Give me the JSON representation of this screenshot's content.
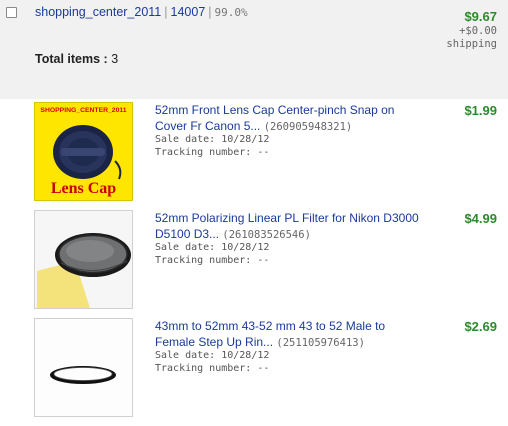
{
  "seller": {
    "name": "shopping_center_2011",
    "feedback_score": "14007",
    "positive_pct": "99.0%"
  },
  "order": {
    "total_price": "$9.67",
    "shipping_cost": "+$0.00",
    "shipping_label": "shipping",
    "total_items_label": "Total items :",
    "total_items_count": "3"
  },
  "items": [
    {
      "title": "52mm Front Lens Cap Center-pinch Snap on Cover Fr Canon 5...",
      "item_number": "(260905948321)",
      "sale_date": "Sale date: 10/28/12",
      "tracking": "Tracking number: --",
      "price": "$1.99",
      "thumb_text_top": "SHOPPING_CENTER_2011",
      "thumb_text_bottom": "Lens Cap"
    },
    {
      "title": "52mm Polarizing Linear PL Filter for Nikon D3000 D5100 D3...",
      "item_number": "(261083526546)",
      "sale_date": "Sale date: 10/28/12",
      "tracking": "Tracking number: --",
      "price": "$4.99"
    },
    {
      "title": "43mm to 52mm 43-52 mm 43 to 52 Male to Female Step Up Rin...",
      "item_number": "(251105976413)",
      "sale_date": "Sale date: 10/28/12",
      "tracking": "Tracking number: --",
      "price": "$2.69"
    }
  ]
}
